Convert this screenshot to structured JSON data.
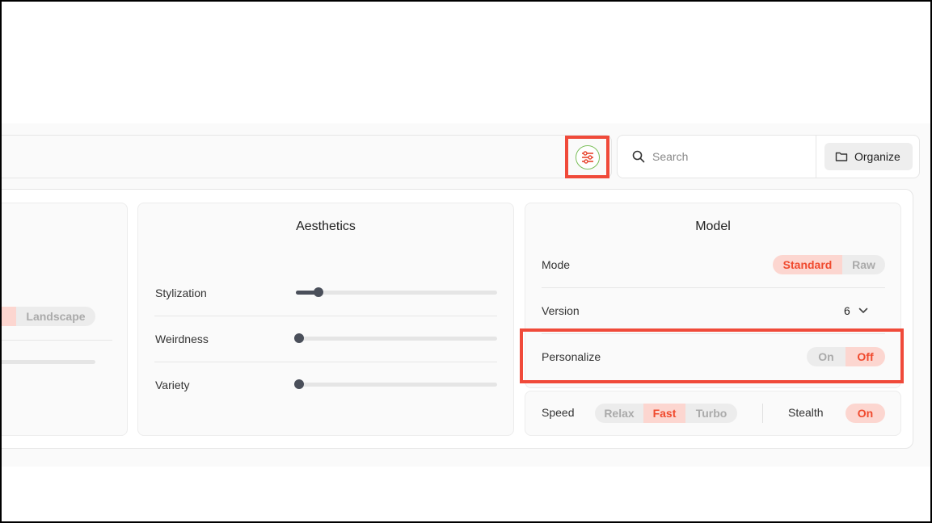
{
  "toolbar": {
    "filter_icon": "sliders-icon",
    "search_placeholder": "Search",
    "organize_label": "Organize"
  },
  "aspect": {
    "options": [
      "re",
      "Landscape"
    ],
    "selected": "re"
  },
  "aesthetics": {
    "title": "Aesthetics",
    "stylization": {
      "label": "Stylization",
      "value": 0.11
    },
    "weirdness": {
      "label": "Weirdness",
      "value": 0.0
    },
    "variety": {
      "label": "Variety",
      "value": 0.0
    }
  },
  "model": {
    "title": "Model",
    "mode": {
      "label": "Mode",
      "options": [
        "Standard",
        "Raw"
      ],
      "selected": "Standard"
    },
    "version": {
      "label": "Version",
      "value": "6"
    },
    "personalize": {
      "label": "Personalize",
      "options": [
        "On",
        "Off"
      ],
      "selected": "Off"
    }
  },
  "speed": {
    "label": "Speed",
    "options": [
      "Relax",
      "Fast",
      "Turbo"
    ],
    "selected": "Fast",
    "stealth_label": "Stealth",
    "stealth_value": "On"
  },
  "colors": {
    "accent": "#f04a2e",
    "accent_bg": "#fcd6d0",
    "highlight": "#f04a3a"
  }
}
